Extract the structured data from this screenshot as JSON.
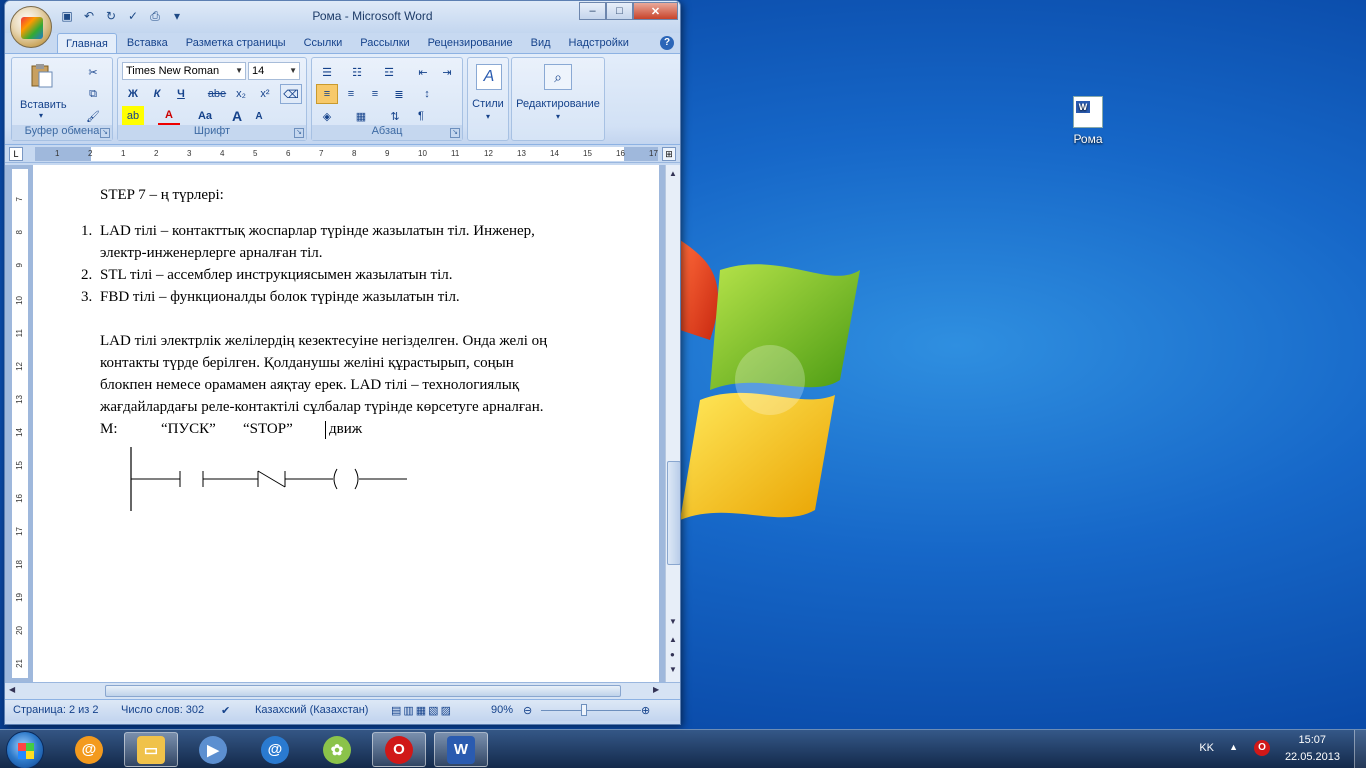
{
  "desktop": {
    "icon_label": "Рома"
  },
  "window": {
    "title": "Рома - Microsoft Word",
    "controls": {
      "minimize": "–",
      "maximize": "□",
      "close": "✕"
    }
  },
  "tabs": [
    "Главная",
    "Вставка",
    "Разметка страницы",
    "Ссылки",
    "Рассылки",
    "Рецензирование",
    "Вид",
    "Надстройки"
  ],
  "ribbon": {
    "clipboard": {
      "paste": "Вставить",
      "label": "Буфер обмена"
    },
    "font": {
      "family": "Times New Roman",
      "size": "14",
      "bold": "Ж",
      "italic": "К",
      "underline": "Ч",
      "strike": "abe",
      "sub": "x₂",
      "sup": "x²",
      "case": "Aa",
      "grow": "A",
      "shrink": "A",
      "highlight": "ab",
      "color": "A",
      "label": "Шрифт"
    },
    "paragraph": {
      "label": "Абзац",
      "pilcrow": "¶"
    },
    "styles": {
      "label": "Стили"
    },
    "editing": {
      "label": "Редактирование"
    }
  },
  "ruler": {
    "marks": [
      "1",
      "2",
      "1",
      "2",
      "3",
      "4",
      "5",
      "6",
      "7",
      "8",
      "9",
      "10",
      "11",
      "12",
      "13",
      "14",
      "15",
      "16",
      "17"
    ]
  },
  "vruler": {
    "marks": [
      "7",
      "8",
      "9",
      "10",
      "11",
      "12",
      "13",
      "14",
      "15",
      "16",
      "17",
      "18",
      "19",
      "20",
      "21"
    ]
  },
  "document": {
    "heading": "STEP 7 – ң түрлері:",
    "list": [
      {
        "num": "1.",
        "lines": [
          "LAD тілі – контакттық жоспарлар түрінде жазылатын тіл. Инженер,",
          "электр-инженерлерге арналған тіл."
        ]
      },
      {
        "num": "2.",
        "lines": [
          "STL тілі – ассемблер инструкциясымен жазылатын тіл."
        ]
      },
      {
        "num": "3.",
        "lines": [
          "FBD тілі – функционалды болок түрінде жазылатын тіл."
        ]
      }
    ],
    "paragraph": [
      "LAD тілі электрлік желілердің кезектесуіне негізделген. Онда желі оң",
      "контакты түрде берілген. Қолданушы желіні құрастырып, соңын",
      "блокпен немесе орамамен аяқтау ерек. LAD тілі – технологиялық",
      "жағдайлардағы реле-контактілі сұлбалар түрінде көрсетуге арналған."
    ],
    "ladder_labels": {
      "m": "M:",
      "start": "“ПУСК”",
      "stop": "“STOP”",
      "motor": "движ"
    }
  },
  "status": {
    "page": "Страница: 2 из 2",
    "words": "Число слов: 302",
    "language": "Казахский (Казахстан)",
    "zoom": "90%"
  },
  "taskbar": {
    "lang": "KK",
    "time": "15:07",
    "date": "22.05.2013"
  }
}
